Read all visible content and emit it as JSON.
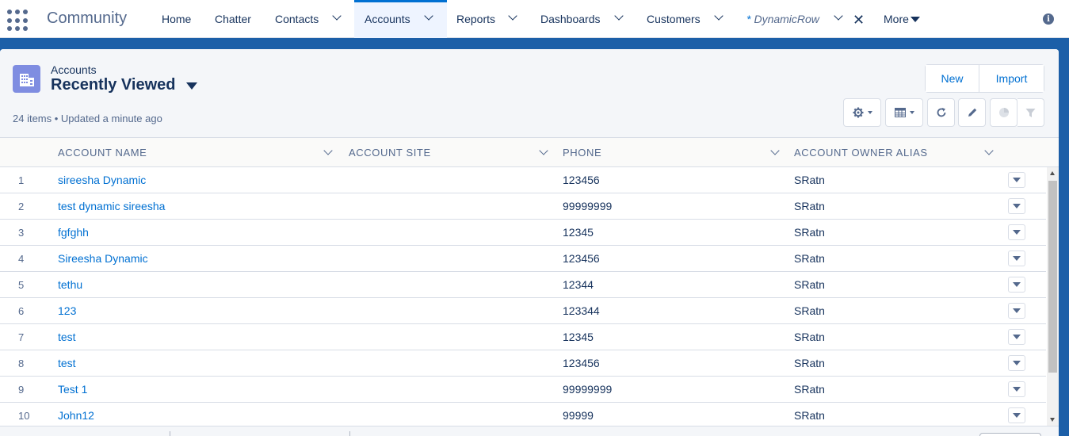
{
  "app": {
    "name": "Community"
  },
  "nav": {
    "items": [
      {
        "label": "Home"
      },
      {
        "label": "Chatter"
      },
      {
        "label": "Contacts"
      },
      {
        "label": "Accounts"
      },
      {
        "label": "Reports"
      },
      {
        "label": "Dashboards"
      },
      {
        "label": "Customers"
      },
      {
        "label": "DynamicRow",
        "prefix": "*"
      }
    ],
    "more_label": "More",
    "active": "Accounts"
  },
  "list_view": {
    "object_label": "Accounts",
    "view_name": "Recently Viewed",
    "meta": "24 items • Updated a minute ago",
    "buttons": {
      "new": "New",
      "import": "Import"
    }
  },
  "table": {
    "columns": [
      "ACCOUNT NAME",
      "ACCOUNT SITE",
      "PHONE",
      "ACCOUNT OWNER ALIAS"
    ],
    "rows": [
      {
        "num": "1",
        "name": "sireesha Dynamic",
        "site": "",
        "phone": "123456",
        "alias": "SRatn"
      },
      {
        "num": "2",
        "name": "test dynamic sireesha",
        "site": "",
        "phone": "99999999",
        "alias": "SRatn"
      },
      {
        "num": "3",
        "name": "fgfghh",
        "site": "",
        "phone": "12345",
        "alias": "SRatn"
      },
      {
        "num": "4",
        "name": "Sireesha Dynamic",
        "site": "",
        "phone": "123456",
        "alias": "SRatn"
      },
      {
        "num": "5",
        "name": "tethu",
        "site": "",
        "phone": "12344",
        "alias": "SRatn"
      },
      {
        "num": "6",
        "name": "123",
        "site": "",
        "phone": "123344",
        "alias": "SRatn"
      },
      {
        "num": "7",
        "name": "test",
        "site": "",
        "phone": "12345",
        "alias": "SRatn"
      },
      {
        "num": "8",
        "name": "test",
        "site": "",
        "phone": "123456",
        "alias": "SRatn"
      },
      {
        "num": "9",
        "name": "Test 1",
        "site": "",
        "phone": "99999999",
        "alias": "SRatn"
      },
      {
        "num": "10",
        "name": "John12",
        "site": "",
        "phone": "99999",
        "alias": "SRatn"
      }
    ]
  },
  "icons": {
    "app_launcher": "waffle-icon",
    "object": "building-icon",
    "settings": "gear-icon",
    "display": "table-icon",
    "refresh": "refresh-icon",
    "edit": "pencil-icon",
    "charts": "pie-chart-icon",
    "filter": "filter-icon",
    "info": "info-icon"
  },
  "colors": {
    "brand": "#0070d2",
    "header_bg": "#f4f6f9",
    "object_icon": "#7f8de1",
    "page_bg": "#1c5fa8"
  }
}
